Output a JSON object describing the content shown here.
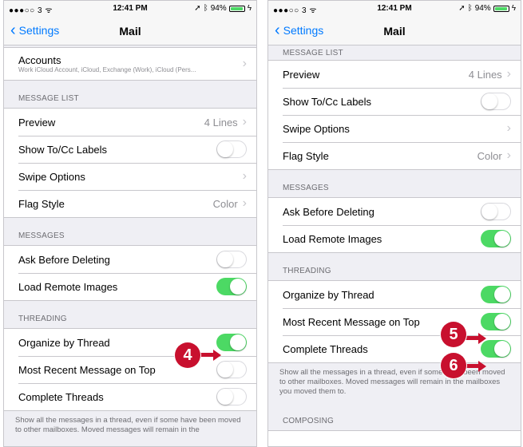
{
  "status_bar": {
    "carrier": "●●●○○ 3 ᯤ",
    "time": "12:41 PM",
    "battery_text": "94%",
    "battery_level": 0.94,
    "icons": [
      "location-arrow-icon",
      "bluetooth-icon",
      "battery-icon",
      "charging-icon"
    ]
  },
  "nav": {
    "back_label": "Settings",
    "title": "Mail"
  },
  "left": {
    "accounts": {
      "title": "Accounts",
      "subtitle": "Work iCloud Account, iCloud, Exchange (Work), iCloud (Pers..."
    },
    "message_list_header": "MESSAGE LIST",
    "preview": {
      "label": "Preview",
      "value": "4 Lines"
    },
    "show_tocc": {
      "label": "Show To/Cc Labels",
      "on": false
    },
    "swipe_options": {
      "label": "Swipe Options"
    },
    "flag_style": {
      "label": "Flag Style",
      "value": "Color"
    },
    "messages_header": "MESSAGES",
    "ask_before_deleting": {
      "label": "Ask Before Deleting",
      "on": false
    },
    "load_remote_images": {
      "label": "Load Remote Images",
      "on": true
    },
    "threading_header": "THREADING",
    "organize_by_thread": {
      "label": "Organize by Thread",
      "on": true
    },
    "most_recent_on_top": {
      "label": "Most Recent Message on Top",
      "on": false
    },
    "complete_threads": {
      "label": "Complete Threads",
      "on": false
    },
    "threading_footer": "Show all the messages in a thread, even if some have been moved to other mailboxes. Moved messages will remain in the"
  },
  "right": {
    "message_list_header": "MESSAGE LIST",
    "preview": {
      "label": "Preview",
      "value": "4 Lines"
    },
    "show_tocc": {
      "label": "Show To/Cc Labels",
      "on": false
    },
    "swipe_options": {
      "label": "Swipe Options"
    },
    "flag_style": {
      "label": "Flag Style",
      "value": "Color"
    },
    "messages_header": "MESSAGES",
    "ask_before_deleting": {
      "label": "Ask Before Deleting",
      "on": false
    },
    "load_remote_images": {
      "label": "Load Remote Images",
      "on": true
    },
    "threading_header": "THREADING",
    "organize_by_thread": {
      "label": "Organize by Thread",
      "on": true
    },
    "most_recent_on_top": {
      "label": "Most Recent Message on Top",
      "on": true
    },
    "complete_threads": {
      "label": "Complete Threads",
      "on": true
    },
    "threading_footer": "Show all the messages in a thread, even if some have been moved to other mailboxes. Moved messages will remain in the mailboxes you moved them to.",
    "composing_header": "COMPOSING"
  },
  "callouts": [
    "4",
    "5",
    "6"
  ],
  "colors": {
    "ios_blue": "#007aff",
    "switch_on": "#4cd964",
    "callout_red": "#c8102e"
  }
}
